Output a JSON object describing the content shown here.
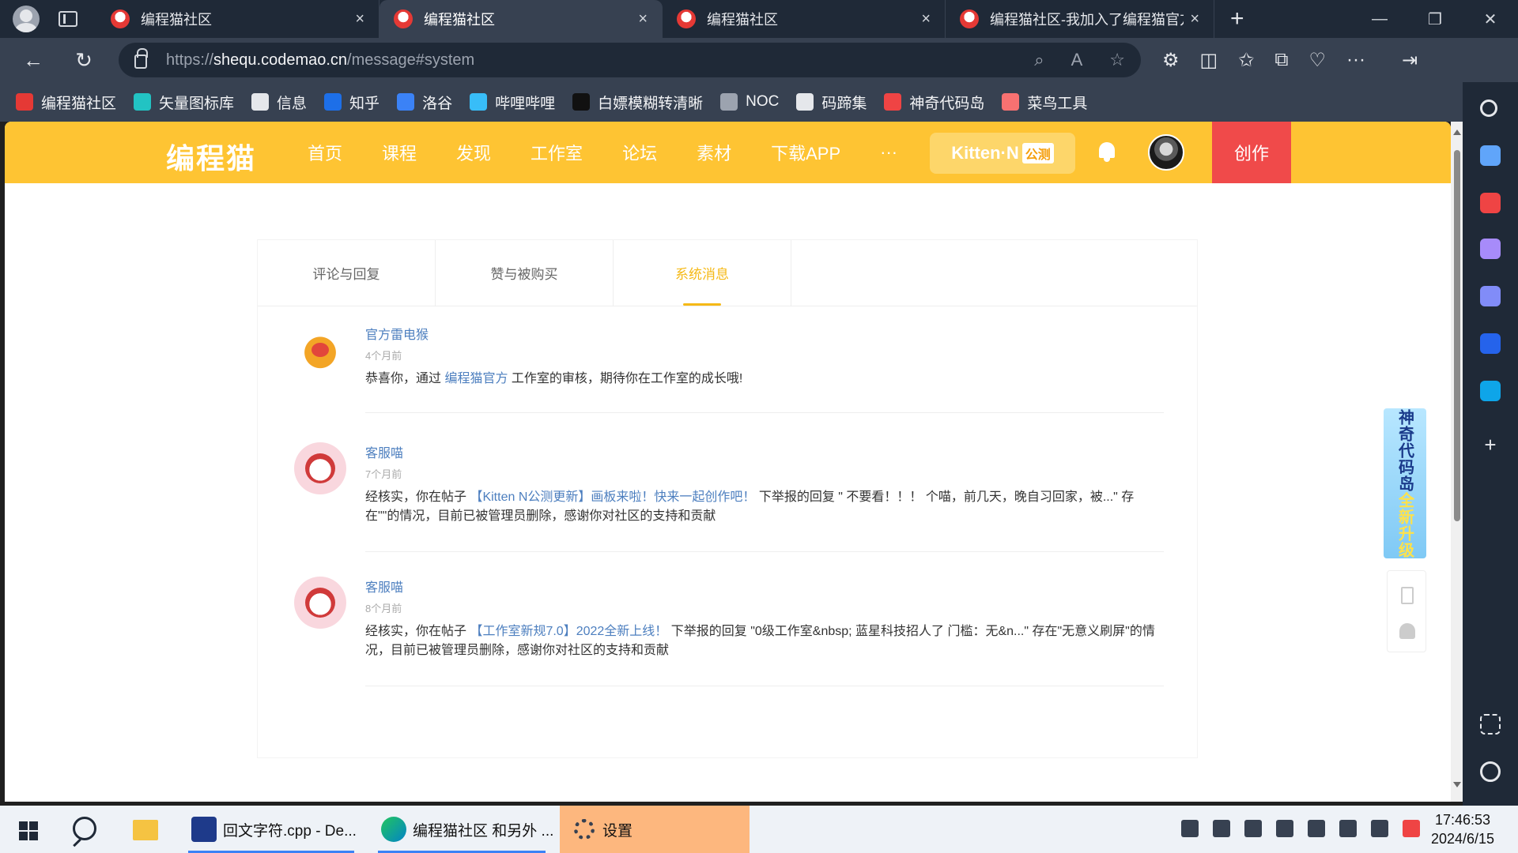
{
  "browser": {
    "tabs": [
      {
        "title": "编程猫社区",
        "active": false
      },
      {
        "title": "编程猫社区",
        "active": true
      },
      {
        "title": "编程猫社区",
        "active": false
      },
      {
        "title": "编程猫社区-我加入了编程猫官方",
        "active": false
      }
    ],
    "tab_close": "×",
    "new_tab": "+",
    "url_prefix": "https://",
    "url_host": "shequ.codemao.cn",
    "url_path": "/message#system",
    "bookmarks": [
      {
        "label": "编程猫社区",
        "color": "#e53935"
      },
      {
        "label": "矢量图标库",
        "color": "#22c3c3"
      },
      {
        "label": "信息",
        "color": "#e5e7eb"
      },
      {
        "label": "知乎",
        "color": "#1d6fe8"
      },
      {
        "label": "洛谷",
        "color": "#3b82f6"
      },
      {
        "label": "哔哩哔哩",
        "color": "#38bdf8"
      },
      {
        "label": "白嫖模糊转清晰",
        "color": "#111111"
      },
      {
        "label": "NOC",
        "color": "#9ca3af"
      },
      {
        "label": "码蹄集",
        "color": "#e5e7eb"
      },
      {
        "label": "神奇代码岛",
        "color": "#ef4444"
      },
      {
        "label": "菜鸟工具",
        "color": "#f87171"
      }
    ]
  },
  "site": {
    "logo": "编程猫",
    "nav": [
      "首页",
      "课程",
      "发现",
      "工作室",
      "论坛",
      "素材",
      "下载APP",
      "···"
    ],
    "kitten_label": "Kitten·N",
    "kitten_badge": "公测",
    "create_label": "创作"
  },
  "message_tabs": [
    {
      "label": "评论与回复",
      "active": false
    },
    {
      "label": "赞与被购买",
      "active": false
    },
    {
      "label": "系统消息",
      "active": true
    }
  ],
  "messages": [
    {
      "sender": "官方雷电猴",
      "time": "4个月前",
      "avatar": "official",
      "parts": [
        {
          "text": "恭喜你，通过 ",
          "link": false
        },
        {
          "text": "编程猫官方",
          "link": true
        },
        {
          "text": " 工作室的审核，期待你在工作室的成长哦!",
          "link": false
        }
      ]
    },
    {
      "sender": "客服喵",
      "time": "7个月前",
      "avatar": "service",
      "parts": [
        {
          "text": "经核实，你在帖子 ",
          "link": false
        },
        {
          "text": "【Kitten N公测更新】画板来啦！快来一起创作吧！",
          "link": true
        },
        {
          "text": " 下举报的回复 \" 不要看！！！ 个喵，前几天，晚自习回家，被...\" 存在\"\"的情况，目前已被管理员删除，感谢你对社区的支持和贡献",
          "link": false
        }
      ]
    },
    {
      "sender": "客服喵",
      "time": "8个月前",
      "avatar": "service",
      "parts": [
        {
          "text": "经核实，你在帖子 ",
          "link": false
        },
        {
          "text": "【工作室新规7.0】2022全新上线！",
          "link": true
        },
        {
          "text": " 下举报的回复 \"0级工作室&nbsp; 蓝星科技招人了 门槛：无&n...\" 存在\"无意义刷屏\"的情况，目前已被管理员删除，感谢你对社区的支持和贡献",
          "link": false
        }
      ]
    }
  ],
  "float_banner": {
    "main": "神奇代码岛",
    "accent": "全新升级"
  },
  "taskbar": {
    "apps": [
      {
        "label": "回文字符.cpp - De...",
        "active": true
      },
      {
        "label": "编程猫社区 和另外 ...",
        "active": true
      },
      {
        "label": "设置",
        "active": false
      }
    ],
    "time": "17:46:53",
    "date": "2024/6/15"
  },
  "colors": {
    "header": "#fec433",
    "accent": "#f5b916",
    "create": "#f04a4a",
    "link": "#4d7fbf"
  }
}
